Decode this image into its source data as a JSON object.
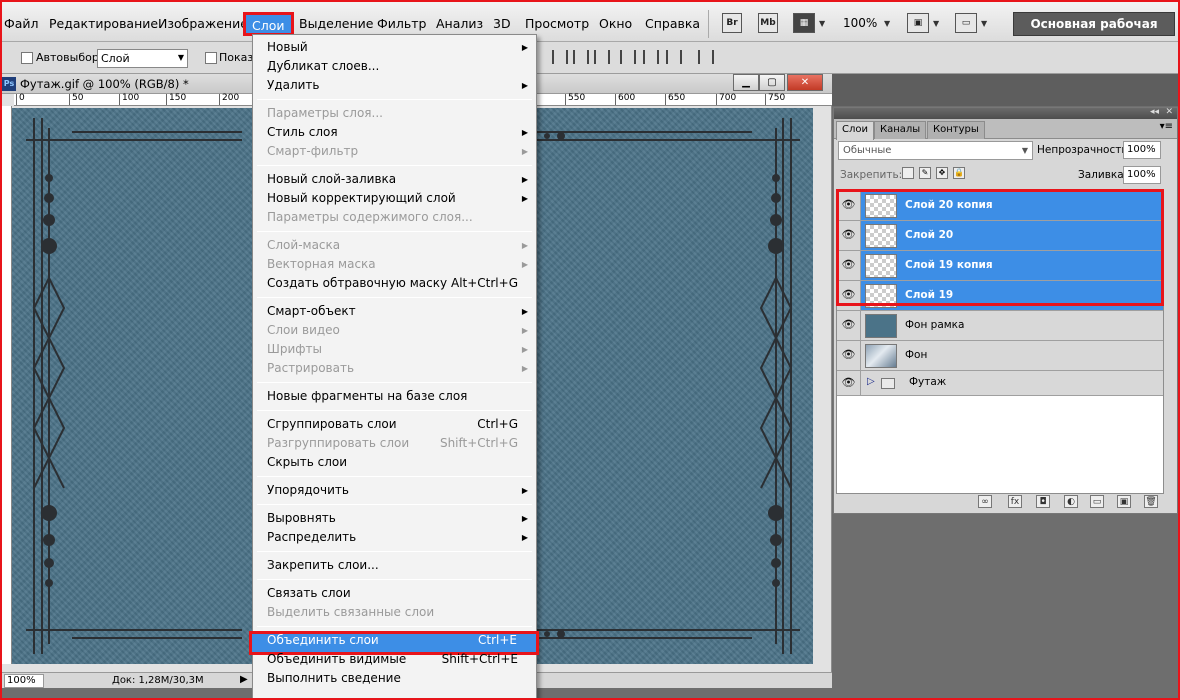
{
  "menubar": {
    "items": [
      "Файл",
      "Редактирование",
      "Изображение",
      "Слои",
      "Выделение",
      "Фильтр",
      "Анализ",
      "3D",
      "Просмотр",
      "Окно",
      "Справка"
    ],
    "active": "Слои",
    "bridge_icon": "Br",
    "minibridge_icon": "Mb",
    "zoom": "100%",
    "workspace": "Основная рабочая среда"
  },
  "options": {
    "autoselect_label": "Автовыбор:",
    "layer_select_value": "Слой",
    "show_label": "Показ"
  },
  "document": {
    "title": "Футаж.gif @ 100% (RGB/8) *",
    "ruler_ticks": [
      "0",
      "50",
      "100",
      "150",
      "200",
      "550",
      "600",
      "650",
      "700",
      "750"
    ],
    "zoom_field": "100%",
    "doc_size": "Док: 1,28M/30,3M"
  },
  "dropdown": {
    "items": [
      {
        "label": "Новый",
        "shortcut": "",
        "submenu": true,
        "disabled": false
      },
      {
        "label": "Дубликат слоев...",
        "shortcut": "",
        "submenu": false,
        "disabled": false
      },
      {
        "label": "Удалить",
        "shortcut": "",
        "submenu": true,
        "disabled": false
      },
      {
        "label": "Параметры слоя...",
        "shortcut": "",
        "submenu": false,
        "disabled": true
      },
      {
        "label": "Стиль слоя",
        "shortcut": "",
        "submenu": true,
        "disabled": false
      },
      {
        "label": "Смарт-фильтр",
        "shortcut": "",
        "submenu": true,
        "disabled": true
      },
      {
        "label": "Новый слой-заливка",
        "shortcut": "",
        "submenu": true,
        "disabled": false
      },
      {
        "label": "Новый корректирующий слой",
        "shortcut": "",
        "submenu": true,
        "disabled": false
      },
      {
        "label": "Параметры содержимого слоя...",
        "shortcut": "",
        "submenu": false,
        "disabled": true
      },
      {
        "label": "Слой-маска",
        "shortcut": "",
        "submenu": true,
        "disabled": true
      },
      {
        "label": "Векторная маска",
        "shortcut": "",
        "submenu": true,
        "disabled": true
      },
      {
        "label": "Создать обтравочную маску",
        "shortcut": "Alt+Ctrl+G",
        "submenu": false,
        "disabled": false
      },
      {
        "label": "Смарт-объект",
        "shortcut": "",
        "submenu": true,
        "disabled": false
      },
      {
        "label": "Слои видео",
        "shortcut": "",
        "submenu": true,
        "disabled": true
      },
      {
        "label": "Шрифты",
        "shortcut": "",
        "submenu": true,
        "disabled": true
      },
      {
        "label": "Растрировать",
        "shortcut": "",
        "submenu": true,
        "disabled": true
      },
      {
        "label": "Новые фрагменты на базе слоя",
        "shortcut": "",
        "submenu": false,
        "disabled": false
      },
      {
        "label": "Сгруппировать слои",
        "shortcut": "Ctrl+G",
        "submenu": false,
        "disabled": false
      },
      {
        "label": "Разгруппировать слои",
        "shortcut": "Shift+Ctrl+G",
        "submenu": false,
        "disabled": true
      },
      {
        "label": "Скрыть слои",
        "shortcut": "",
        "submenu": false,
        "disabled": false
      },
      {
        "label": "Упорядочить",
        "shortcut": "",
        "submenu": true,
        "disabled": false
      },
      {
        "label": "Выровнять",
        "shortcut": "",
        "submenu": true,
        "disabled": false
      },
      {
        "label": "Распределить",
        "shortcut": "",
        "submenu": true,
        "disabled": false
      },
      {
        "label": "Закрепить слои...",
        "shortcut": "",
        "submenu": false,
        "disabled": false
      },
      {
        "label": "Связать слои",
        "shortcut": "",
        "submenu": false,
        "disabled": false
      },
      {
        "label": "Выделить связанные слои",
        "shortcut": "",
        "submenu": false,
        "disabled": true
      },
      {
        "label": "Объединить слои",
        "shortcut": "Ctrl+E",
        "submenu": false,
        "disabled": false,
        "highlight": true
      },
      {
        "label": "Объединить видимые",
        "shortcut": "Shift+Ctrl+E",
        "submenu": false,
        "disabled": false
      },
      {
        "label": "Выполнить сведение",
        "shortcut": "",
        "submenu": false,
        "disabled": false
      }
    ]
  },
  "panel": {
    "tabs": [
      "Слои",
      "Каналы",
      "Контуры"
    ],
    "blend_mode": "Обычные",
    "opacity_label": "Непрозрачность:",
    "opacity": "100%",
    "lock_label": "Закрепить:",
    "fill_label": "Заливка:",
    "fill": "100%",
    "layers": [
      {
        "name": "Слой 20 копия",
        "selected": true,
        "thumb": "transparent"
      },
      {
        "name": "Слой 20",
        "selected": true,
        "thumb": "transparent"
      },
      {
        "name": "Слой 19 копия",
        "selected": true,
        "thumb": "transparent"
      },
      {
        "name": "Слой 19",
        "selected": true,
        "thumb": "transparent"
      },
      {
        "name": "Фон рамка",
        "selected": false,
        "thumb": "blue"
      },
      {
        "name": "Фон",
        "selected": false,
        "thumb": "image"
      }
    ],
    "group": {
      "name": "Футаж"
    },
    "footer_icons": [
      "link-icon",
      "fx-icon",
      "mask-icon",
      "adjustment-icon",
      "folder-icon",
      "new-layer-icon",
      "trash-icon"
    ]
  },
  "colors": {
    "accent": "#3d8ee6",
    "highlight_border": "#e8141a",
    "canvas": "#4b7388"
  }
}
